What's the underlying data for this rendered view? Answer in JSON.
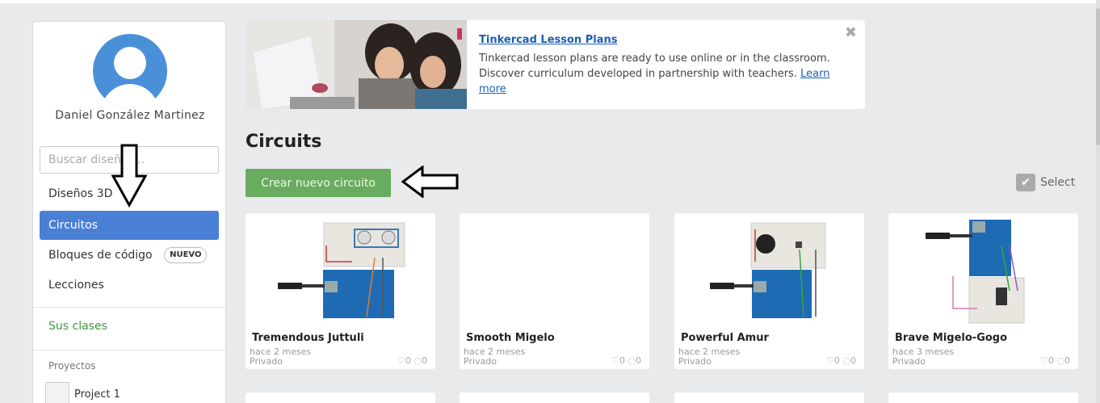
{
  "user": {
    "name": "Daniel González Martinez"
  },
  "sidebar": {
    "search_placeholder": "Buscar diseños...",
    "items": [
      {
        "label": "Diseños 3D"
      },
      {
        "label": "Circuitos"
      },
      {
        "label": "Bloques de código",
        "badge": "NUEVO"
      },
      {
        "label": "Lecciones"
      }
    ],
    "classes_link": "Sus clases",
    "projects_label": "Proyectos",
    "projects": [
      {
        "label": "Project 1"
      }
    ]
  },
  "banner": {
    "title": "Tinkercad Lesson Plans",
    "text": "Tinkercad lesson plans are ready to use online or in the classroom. Discover curriculum developed in partnership with teachers.",
    "link": "Learn more",
    "close": "✖"
  },
  "main": {
    "heading": "Circuits",
    "create_button": "Crear nuevo circuito",
    "select_label": "Select"
  },
  "cards": [
    {
      "name": "Tremendous Juttuli",
      "date": "hace 2 meses",
      "privacy": "Privado",
      "likes": "0",
      "comments": "0"
    },
    {
      "name": "Smooth Migelo",
      "date": "hace 2 meses",
      "privacy": "Privado",
      "likes": "0",
      "comments": "0"
    },
    {
      "name": "Powerful Amur",
      "date": "hace 2 meses",
      "privacy": "Privado",
      "likes": "0",
      "comments": "0"
    },
    {
      "name": "Brave Migelo-Gogo",
      "date": "hace 3 meses",
      "privacy": "Privado",
      "likes": "0",
      "comments": "0"
    }
  ],
  "colors": {
    "accent_blue": "#4a7fd6",
    "create_green": "#6aac5f",
    "classes_green": "#3a9c3a"
  }
}
